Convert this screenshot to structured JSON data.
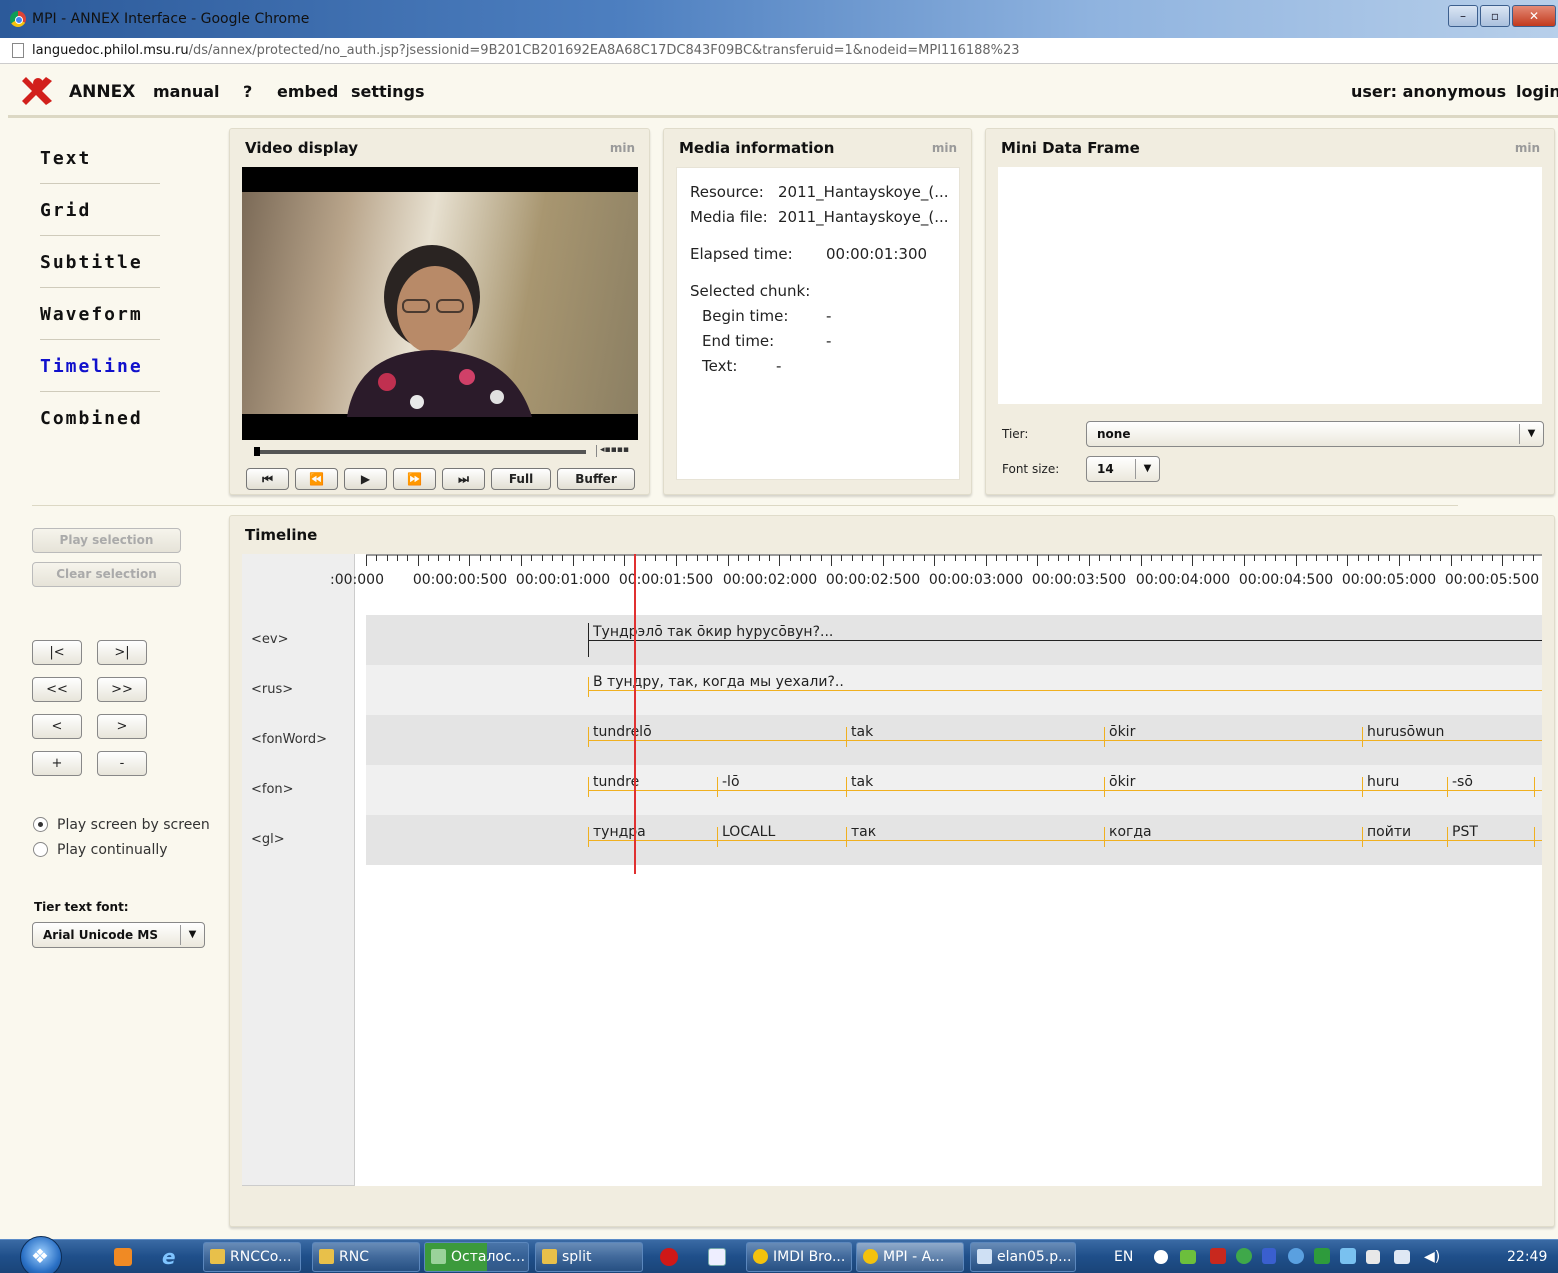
{
  "browser": {
    "window_title": "MPI - ANNEX Interface - Google Chrome",
    "url_host": "languedoc.philol.msu.ru",
    "url_path": "/ds/annex/protected/no_auth.jsp?jsessionid=9B201CB201692EA8A68C17DC843F09BC&transferuid=1&nodeid=MPI116188%23"
  },
  "header": {
    "app_name": "ANNEX",
    "menu": [
      "manual",
      "?",
      "embed",
      "settings"
    ],
    "user": "user: anonymous",
    "login": "login"
  },
  "sidebar": {
    "items": [
      {
        "label": "Text"
      },
      {
        "label": "Grid"
      },
      {
        "label": "Subtitle"
      },
      {
        "label": "Waveform"
      },
      {
        "label": "Timeline",
        "active": true
      },
      {
        "label": "Combined"
      }
    ]
  },
  "video_panel": {
    "title": "Video display",
    "min": "min",
    "buttons": [
      "⏮",
      "⏪",
      "▶",
      "⏩",
      "⏭",
      "Full",
      "Buffer"
    ]
  },
  "media_panel": {
    "title": "Media information",
    "min": "min",
    "resource_label": "Resource:",
    "resource_value": "2011_Hantayskoye_(...",
    "media_file_label": "Media file:",
    "media_file_value": "2011_Hantayskoye_(...",
    "elapsed_label": "Elapsed time:",
    "elapsed_value": "00:00:01:300",
    "selected_chunk_label": "Selected chunk:",
    "begin_label": "Begin time:",
    "begin_value": "-",
    "end_label": "End time:",
    "end_value": "-",
    "text_label": "Text:",
    "text_value": "-"
  },
  "mini_panel": {
    "title": "Mini Data Frame",
    "min": "min",
    "tier_label": "Tier:",
    "tier_value": "none",
    "font_size_label": "Font size:",
    "font_size_value": "14"
  },
  "controls": {
    "play_selection": "Play selection",
    "clear_selection": "Clear selection",
    "nav_buttons": [
      "|<",
      ">|",
      "<<",
      ">>",
      "<",
      ">",
      "+",
      "-"
    ],
    "play_screen": "Play screen by screen",
    "play_continuous": "Play continually",
    "tier_font_label": "Tier text font:",
    "tier_font_value": "Arial Unicode MS"
  },
  "timeline": {
    "title": "Timeline",
    "ticks": [
      ":00:000",
      "00:00:00:500",
      "00:00:01:000",
      "00:00:01:500",
      "00:00:02:000",
      "00:00:02:500",
      "00:00:03:000",
      "00:00:03:500",
      "00:00:04:000",
      "00:00:04:500",
      "00:00:05:000",
      "00:00:05:500"
    ],
    "tiers": [
      {
        "name": "<ev>",
        "annotations": [
          "Тундрэлō так ōкир hурусōвун?..."
        ]
      },
      {
        "name": "<rus>",
        "annotations": [
          "В тундру, так, когда мы уехали?.."
        ]
      },
      {
        "name": "<fonWord>",
        "annotations": [
          "tundrelō",
          "tak",
          "ōkir",
          "hurusōwun"
        ]
      },
      {
        "name": "<fon>",
        "annotations": [
          "tundre",
          "-lō",
          "tak",
          "ōkir",
          "huru",
          "-sō"
        ]
      },
      {
        "name": "<gl>",
        "annotations": [
          "тундра",
          "LOCALL",
          "так",
          "когда",
          "пойти",
          "PST"
        ]
      }
    ]
  },
  "taskbar": {
    "items": [
      "RNCCo...",
      "RNC",
      "Осталос...",
      "split",
      "IMDI Bro...",
      "MPI - A...",
      "elan05.p..."
    ],
    "lang": "EN",
    "clock": "22:49"
  }
}
